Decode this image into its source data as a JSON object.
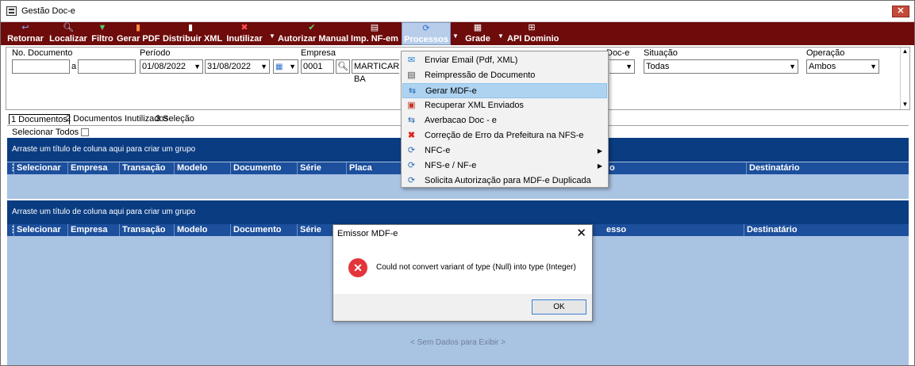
{
  "window": {
    "title": "Gestão Doc-e",
    "close_glyph": "✕"
  },
  "toolbar": {
    "items": [
      {
        "label": "Retornar",
        "icon": "↩",
        "color": "#7fb2ff"
      },
      {
        "label": "Localizar",
        "icon": "🔍︎",
        "color": "#bfe1ff"
      },
      {
        "label": "Filtro",
        "icon": "▼",
        "color": "#4ed36a"
      },
      {
        "label": "Gerar PDF",
        "icon": "▮",
        "color": "#ff8a3d"
      },
      {
        "label": "Distribuir XML",
        "icon": "▮",
        "color": "#ffffff"
      },
      {
        "label": "Inutilizar",
        "icon": "✖",
        "color": "#ff5050"
      },
      {
        "label": "Autorizar Manual",
        "icon": "✔",
        "color": "#5fd65f"
      },
      {
        "label": "Imp. NF-em",
        "icon": "▤",
        "color": "#ffffff"
      },
      {
        "label": "Processos",
        "icon": "⟳",
        "color": "#2f6fcf"
      },
      {
        "label": "Grade",
        "icon": "▦",
        "color": "#ffffff"
      },
      {
        "label": "API Dominio",
        "icon": "⊞",
        "color": "#ffffff"
      }
    ]
  },
  "filters": {
    "doc_label": "No. Documento",
    "doc_sep": "a",
    "periodo_label": "Período",
    "periodo_start": "01/08/2022",
    "periodo_end": "31/08/2022",
    "empresa_label": "Empresa",
    "empresa_code": "0001",
    "empresa_name": "MARTICAR BA",
    "tipo_label": "Doc-e",
    "situacao_label": "Situação",
    "situacao_value": "Todas",
    "operacao_label": "Operação",
    "operacao_value": "Ambos"
  },
  "tabs": [
    {
      "label": "1 Documentos"
    },
    {
      "label": "2 Documentos Inutilizados"
    },
    {
      "label": "3 Seleção"
    }
  ],
  "select_all_label": "Selecionar Todos",
  "grid": {
    "group_hint": "Arraste um título de coluna aqui para criar um grupo",
    "columns_top": [
      "Selecionar",
      "Empresa",
      "Transação",
      "Modelo",
      "Documento",
      "Série",
      "Placa",
      "o",
      "Destinatário"
    ],
    "columns_bottom": [
      "Selecionar",
      "Empresa",
      "Transação",
      "Modelo",
      "Documento",
      "Série",
      "esso",
      "Destinatário"
    ],
    "empty_text": "< Sem Dados para Exibir >"
  },
  "menu": {
    "items": [
      {
        "label": "Enviar Email (Pdf, XML)",
        "icon": "✉",
        "color": "#1f7bd6",
        "highlighted": false,
        "submenu": false
      },
      {
        "label": "Reimpressão de Documento",
        "icon": "▤",
        "color": "#4a4a4a",
        "highlighted": false,
        "submenu": false
      },
      {
        "label": "Gerar MDF-e",
        "icon": "⇆",
        "color": "#2c6db5",
        "highlighted": true,
        "submenu": false
      },
      {
        "label": "Recuperar XML Enviados",
        "icon": "▣",
        "color": "#c0392b",
        "highlighted": false,
        "submenu": false
      },
      {
        "label": "Averbacao Doc - e",
        "icon": "⇆",
        "color": "#2c6db5",
        "highlighted": false,
        "submenu": false
      },
      {
        "label": "Correção de Erro da Prefeitura na NFS-e",
        "icon": "✖",
        "color": "#e02020",
        "highlighted": false,
        "submenu": false
      },
      {
        "label": "NFC-e",
        "icon": "⟳",
        "color": "#2c6db5",
        "highlighted": false,
        "submenu": true
      },
      {
        "label": "NFS-e / NF-e",
        "icon": "⟳",
        "color": "#2c6db5",
        "highlighted": false,
        "submenu": true
      },
      {
        "label": "Solicita Autorização para MDF-e Duplicada",
        "icon": "⟳",
        "color": "#2c6db5",
        "highlighted": false,
        "submenu": false
      }
    ]
  },
  "dialog": {
    "title": "Emissor MDF-e",
    "close_glyph": "✕",
    "message": "Could not convert variant of type (Null) into type (Integer)",
    "ok_label": "OK",
    "error_glyph": "✕"
  }
}
